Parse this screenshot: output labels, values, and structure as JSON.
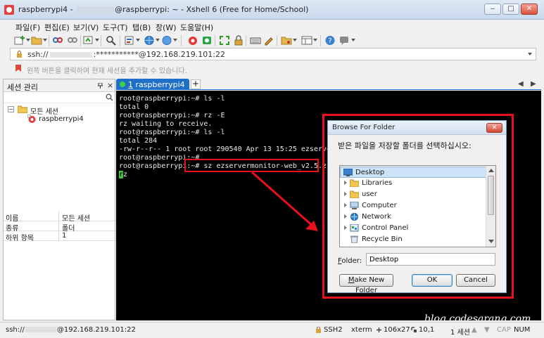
{
  "window": {
    "title_host": "raspberrypi4 - ",
    "title_rest": "@raspberrypi: ~ - Xshell 6 (Free for Home/School)",
    "minimize": "‒",
    "maximize": "□",
    "close": "✕"
  },
  "menu": [
    "파일(F)",
    "편집(E)",
    "보기(V)",
    "도구(T)",
    "탭(B)",
    "창(W)",
    "도움말(H)"
  ],
  "address": {
    "prefix": "ssh://",
    "suffix": ":***********@192.168.219.101:22"
  },
  "hint": "왼쪽 버튼을 클릭하여 현재 세션을 추가할 수 있습니다.",
  "session_panel": {
    "title": "세션 관리",
    "close": "×",
    "tree": {
      "root_expander": "−",
      "root": "모든 세션",
      "child": "raspberrypi4"
    },
    "properties": [
      {
        "key": "이름",
        "value": "모든 세션"
      },
      {
        "key": "종류",
        "value": "폴더"
      },
      {
        "key": "하위 항목",
        "value": "1"
      }
    ]
  },
  "tabs": {
    "active_num": "1",
    "active_label": "raspberrypi4",
    "add": "+",
    "prev": "◀",
    "next": "▶"
  },
  "terminal": {
    "lines": [
      "root@raspberrypi:~# ls -l",
      "total 0",
      "root@raspberrypi:~# rz -E",
      "rz waiting to receive.",
      "root@raspberrypi:~# ls -l",
      "total 284",
      "-rw-r--r-- 1 root root 290540 Apr 13 15:25 ezservermo",
      "root@raspberrypi:~#",
      "root@raspberrypi:~# sz ezservermonitor-web_v2.5.zip"
    ],
    "cursor_char": "r",
    "cursor_rest": "z",
    "watermark": "blog.codesarang.com"
  },
  "dialog": {
    "title": "Browse For Folder",
    "close": "✕",
    "instruction": "받은 파일을 저장할 폴더를 선택하십시오:",
    "folders": [
      {
        "label": "Desktop",
        "expandable": false,
        "selected": true
      },
      {
        "label": "Libraries",
        "expandable": true,
        "selected": false
      },
      {
        "label": "user",
        "expandable": true,
        "selected": false
      },
      {
        "label": "Computer",
        "expandable": true,
        "selected": false
      },
      {
        "label": "Network",
        "expandable": true,
        "selected": false
      },
      {
        "label": "Control Panel",
        "expandable": true,
        "selected": false
      },
      {
        "label": "Recycle Bin",
        "expandable": false,
        "selected": false
      }
    ],
    "folder_label_u": "F",
    "folder_label_rest": "older:",
    "folder_value": "Desktop",
    "make_new_u": "M",
    "make_new_rest": "ake New Folder",
    "ok": "OK",
    "cancel": "Cancel"
  },
  "status": {
    "left_prefix": "ssh://",
    "left_suffix": "@192.168.219.101:22",
    "protocol": "SSH2",
    "terminal_type": "xterm",
    "size": "106x27",
    "cursor_pos": "10,1",
    "sessions": "1 세션",
    "caps": "CAP",
    "num": "NUM"
  },
  "colors": {
    "accent": "#1e6fc8",
    "annotation_red": "#e8101b",
    "terminal_bg": "#000000"
  }
}
